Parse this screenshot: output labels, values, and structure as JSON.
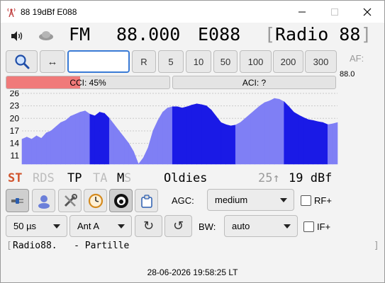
{
  "window": {
    "title": "88 19dBf E088"
  },
  "tuner": {
    "band": "FM",
    "frequency": "88.000",
    "pi_code": "E088",
    "ps_open": "[",
    "ps_name": "Radio 88",
    "ps_close": "]"
  },
  "steps": {
    "swap_label": "↔",
    "input_value": "",
    "reset_label": "R",
    "values": [
      "5",
      "10",
      "50",
      "100",
      "200",
      "300"
    ]
  },
  "af": {
    "label": "AF:",
    "value": "88.0"
  },
  "meters": {
    "cci_text": "CCI: 45%",
    "cci_fraction": 0.45,
    "aci_text": "ACI: ?"
  },
  "spectrum": {
    "y_ticks": [
      "26",
      "23",
      "20",
      "17",
      "14",
      "11"
    ],
    "y_values": [
      26,
      23,
      20,
      17,
      14,
      11
    ],
    "ylim": [
      9,
      26
    ],
    "light_color": "#7f7ff5",
    "dark_color": "#1a1ae6",
    "profile": [
      15,
      15.5,
      15,
      15.8,
      15.2,
      16.5,
      17,
      18,
      19,
      19.5,
      20.5,
      21,
      21.5,
      21.8,
      21,
      20.6,
      21.5,
      21.2,
      20,
      18.5,
      17,
      15.5,
      14,
      12,
      9,
      10.5,
      13,
      17,
      19.5,
      21.5,
      22.5,
      22.8,
      22.8,
      22.5,
      22.8,
      23.2,
      23.5,
      23.3,
      23,
      22,
      20.5,
      19,
      18.5,
      18.2,
      18.4,
      19,
      20,
      21,
      22,
      23,
      23.8,
      24.2,
      24.8,
      24.6,
      24,
      22.8,
      21.5,
      20.8,
      20.2,
      19.7,
      19.5,
      19.2,
      19,
      18.5,
      18.7,
      19
    ],
    "dark_ranges": [
      [
        14,
        18
      ],
      [
        31,
        44
      ],
      [
        54,
        63
      ]
    ]
  },
  "rds_flags": {
    "st": "ST",
    "rds": "RDS",
    "tp": "TP",
    "ta": "TA",
    "m": "M",
    "s": "S",
    "st_color": "#d1542d",
    "inactive_color": "#bdbdbd"
  },
  "pty": "Oldies",
  "signal": {
    "arrow": "25↑",
    "value": "19 dBf"
  },
  "controls": {
    "agc_label": "AGC:",
    "agc_value": "medium",
    "rf_label": "RF+",
    "deemphasis": "50 µs",
    "antenna": "Ant A",
    "bw_label": "BW:",
    "bw_value": "auto",
    "if_label": "IF+",
    "rotate_cw": "↻",
    "rotate_ccw": "↺"
  },
  "radiotext": {
    "open": "[",
    "text": "Radio88.   - Partille",
    "close": "]"
  },
  "clock": "28-06-2026 19:58:25 LT"
}
